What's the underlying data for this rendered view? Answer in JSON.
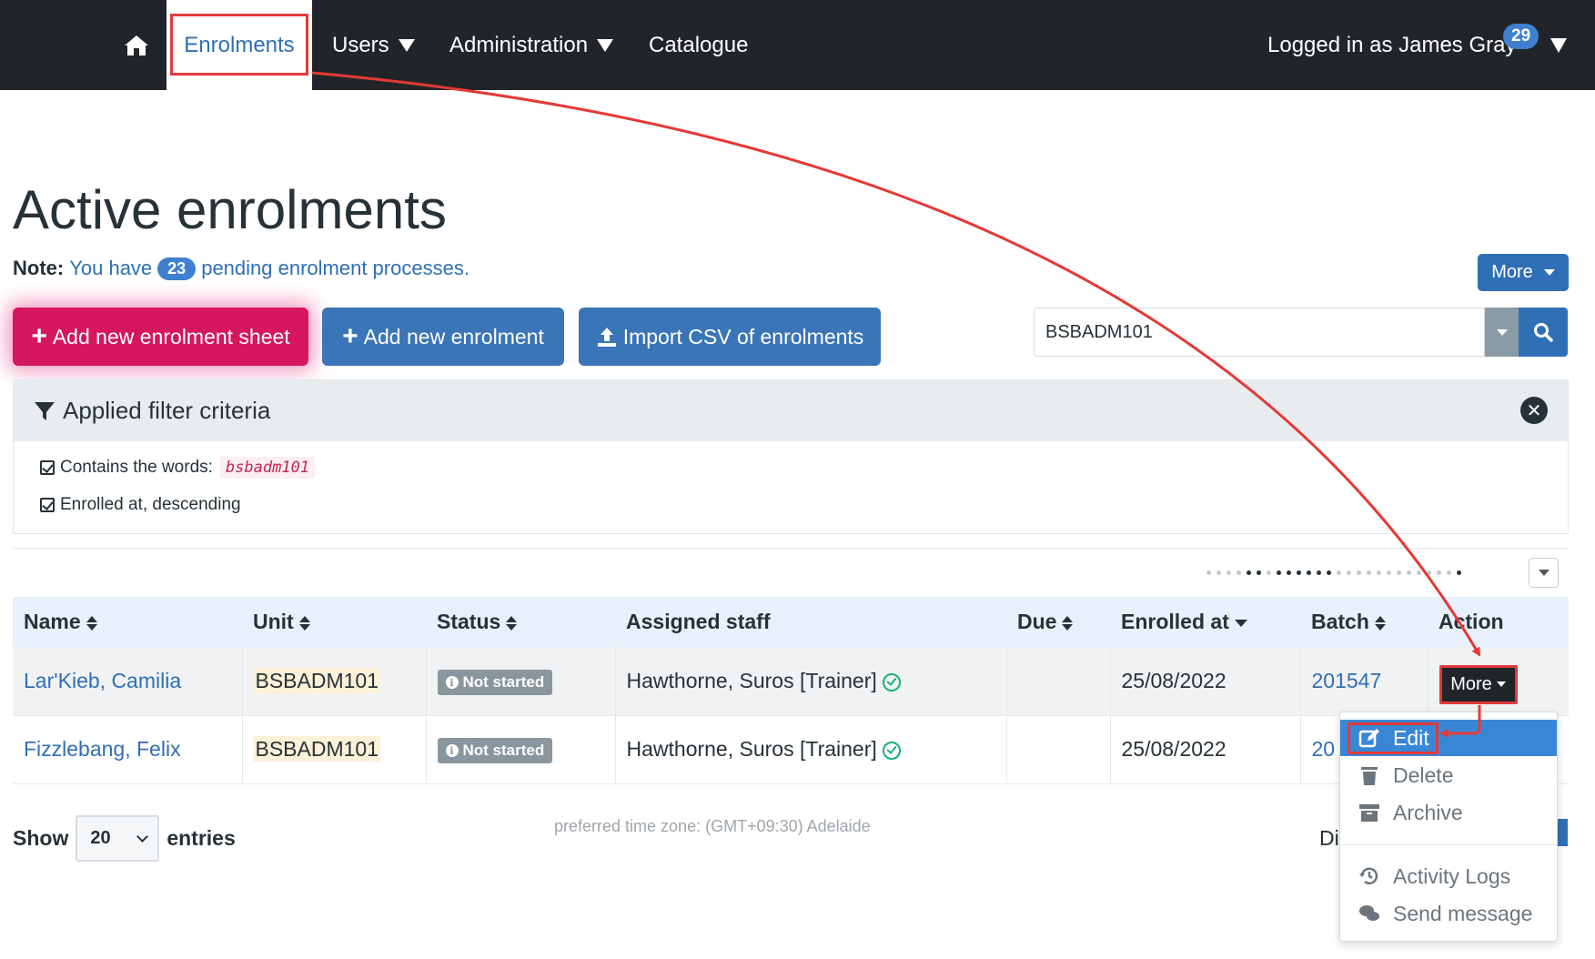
{
  "nav": {
    "items": [
      {
        "label": "Enrolments",
        "active": true
      },
      {
        "label": "Users"
      },
      {
        "label": "Administration"
      },
      {
        "label": "Catalogue"
      }
    ],
    "user_label": "Logged in as James Gray",
    "notification_count": "29"
  },
  "page": {
    "title": "Active enrolments",
    "note_prefix": "Note:",
    "note_before": "You have",
    "pending_count": "23",
    "note_after": "pending enrolment processes.",
    "more_label": "More"
  },
  "actions": {
    "add_sheet": "Add new enrolment sheet",
    "add_enrolment": "Add new enrolment",
    "import_csv": "Import CSV of enrolments"
  },
  "search": {
    "value": "BSBADM101"
  },
  "filter": {
    "title": "Applied filter criteria",
    "contains_label": "Contains the words:",
    "contains_value": "bsbadm101",
    "sort_label": "Enrolled at, descending"
  },
  "table": {
    "headers": {
      "name": "Name",
      "unit": "Unit",
      "status": "Status",
      "staff": "Assigned staff",
      "due": "Due",
      "enrolled": "Enrolled at",
      "batch": "Batch",
      "action": "Action"
    },
    "rows": [
      {
        "name": "Lar'Kieb, Camilia",
        "unit": "BSBADM101",
        "status": "Not started",
        "staff": "Hawthorne, Suros [Trainer]",
        "due": "",
        "enrolled": "25/08/2022",
        "batch": "201547",
        "action": "More"
      },
      {
        "name": "Fizzlebang, Felix",
        "unit": "BSBADM101",
        "status": "Not started",
        "staff": "Hawthorne, Suros [Trainer]",
        "due": "",
        "enrolled": "25/08/2022",
        "batch": "20",
        "action": ""
      }
    ]
  },
  "dropdown": {
    "items": [
      {
        "label": "Edit",
        "icon": "edit-icon",
        "active": true
      },
      {
        "label": "Delete",
        "icon": "trash-icon"
      },
      {
        "label": "Archive",
        "icon": "archive-icon"
      },
      {
        "label": "Activity Logs",
        "icon": "history-icon"
      },
      {
        "label": "Send message",
        "icon": "comments-icon"
      }
    ]
  },
  "footer": {
    "show_label": "Show",
    "page_size": "20",
    "entries_label": "entries",
    "timezone": "preferred time zone: (GMT+09:30) Adelaide",
    "truncated_text": "Di"
  },
  "colors": {
    "navbar": "#212529",
    "primary": "#3a75b8",
    "accent_pink": "#d4175f",
    "annotation_red": "#e03a3a",
    "success": "#18b07a"
  }
}
